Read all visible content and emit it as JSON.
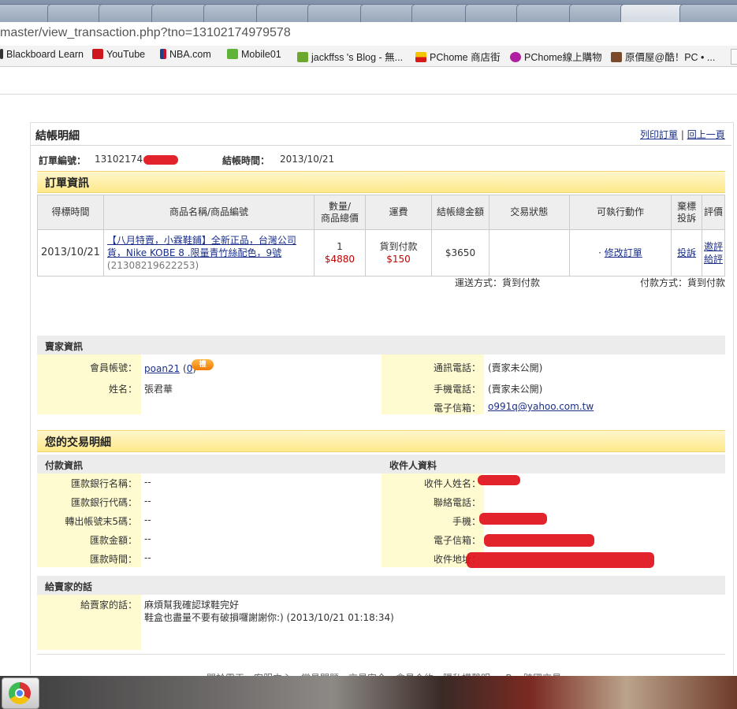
{
  "browser": {
    "address": "master/view_transaction.php?tno=13102174979578",
    "bookmarks": [
      {
        "label": "Blackboard Learn",
        "icon": "blackboard-icon"
      },
      {
        "label": "YouTube",
        "icon": "youtube-icon"
      },
      {
        "label": "NBA.com",
        "icon": "nba-icon"
      },
      {
        "label": "Mobile01",
        "icon": "mobile01-icon"
      },
      {
        "label": "jackffss 's Blog - 無...",
        "icon": "blog-icon"
      },
      {
        "label": "PChome 商店街",
        "icon": "pchome-icon"
      },
      {
        "label": "PChome線上購物",
        "icon": "pchome-shop-icon"
      },
      {
        "label": "原價屋@酷！PC • ...",
        "icon": "coolpc-icon"
      }
    ]
  },
  "page": {
    "title": "結帳明細",
    "print_link": "列印訂單",
    "back_link": "回上一頁",
    "separator": "|"
  },
  "order_meta": {
    "order_no_label": "訂單編號：",
    "order_no_value": "13102174",
    "checkout_time_label": "結帳時間：",
    "checkout_time_value": "2013/10/21"
  },
  "order_section": {
    "title": "訂單資訊",
    "headers": [
      "得標時間",
      "商品名稱/商品編號",
      "數量/\n商品總價",
      "運費",
      "結帳總金額",
      "交易狀態",
      "可執行動作",
      "棄標\n投訴",
      "評價"
    ],
    "row": {
      "won_time": "2013/10/21",
      "product_name": "【八月特賣，小霖鞋鋪】全新正品，台灣公司貨，Nike KOBE 8 .限量青竹絲配色，9號",
      "product_no": "(21308219622253)",
      "qty": "1",
      "total": "$4880",
      "shipping_text": "貨到付款",
      "shipping_fee": "$150",
      "grand_total": "$3650",
      "status": "",
      "action": "修改訂單",
      "complaint": "投訴",
      "review": "邀評給評"
    },
    "delivery_method": "運送方式：貨到付款",
    "payment_method": "付款方式：貨到付款"
  },
  "seller_section": {
    "title": "賣家資訊",
    "account_label": "會員帳號：",
    "account_value": "poan21",
    "account_score": "0",
    "badge": "禮",
    "name_label": "姓名：",
    "name_value": "張君華",
    "phone_label": "通訊電話：",
    "phone_value": "(賣家未公開)",
    "mobile_label": "手機電話：",
    "mobile_value": "(賣家未公開)",
    "email_label": "電子信箱：",
    "email_value": "o991q@yahoo.com.tw"
  },
  "transaction_section": {
    "title": "您的交易明細",
    "payment_head": "付款資訊",
    "receiver_head": "收件人資料",
    "payment_rows": [
      {
        "label": "匯款銀行名稱：",
        "value": "--"
      },
      {
        "label": "匯款銀行代碼：",
        "value": "--"
      },
      {
        "label": "轉出帳號末5碼：",
        "value": "--"
      },
      {
        "label": "匯款金額：",
        "value": "--"
      },
      {
        "label": "匯款時間：",
        "value": "--"
      }
    ],
    "receiver_rows": [
      {
        "label": "收件人姓名："
      },
      {
        "label": "聯絡電話："
      },
      {
        "label": "手機："
      },
      {
        "label": "電子信箱："
      },
      {
        "label": "收件地址："
      }
    ]
  },
  "message_section": {
    "title": "給賣家的話",
    "label": "給賣家的話：",
    "line1": "麻煩幫我確認球鞋完好",
    "line2": "鞋盒也盡量不要有破損囉謝謝你:) (2013/10/21 01:18:34)"
  },
  "footer": {
    "text": "關於露天　客服中心　常見問題　交易安全　會員合約　隱私權聲明　eBay跨國交易"
  }
}
